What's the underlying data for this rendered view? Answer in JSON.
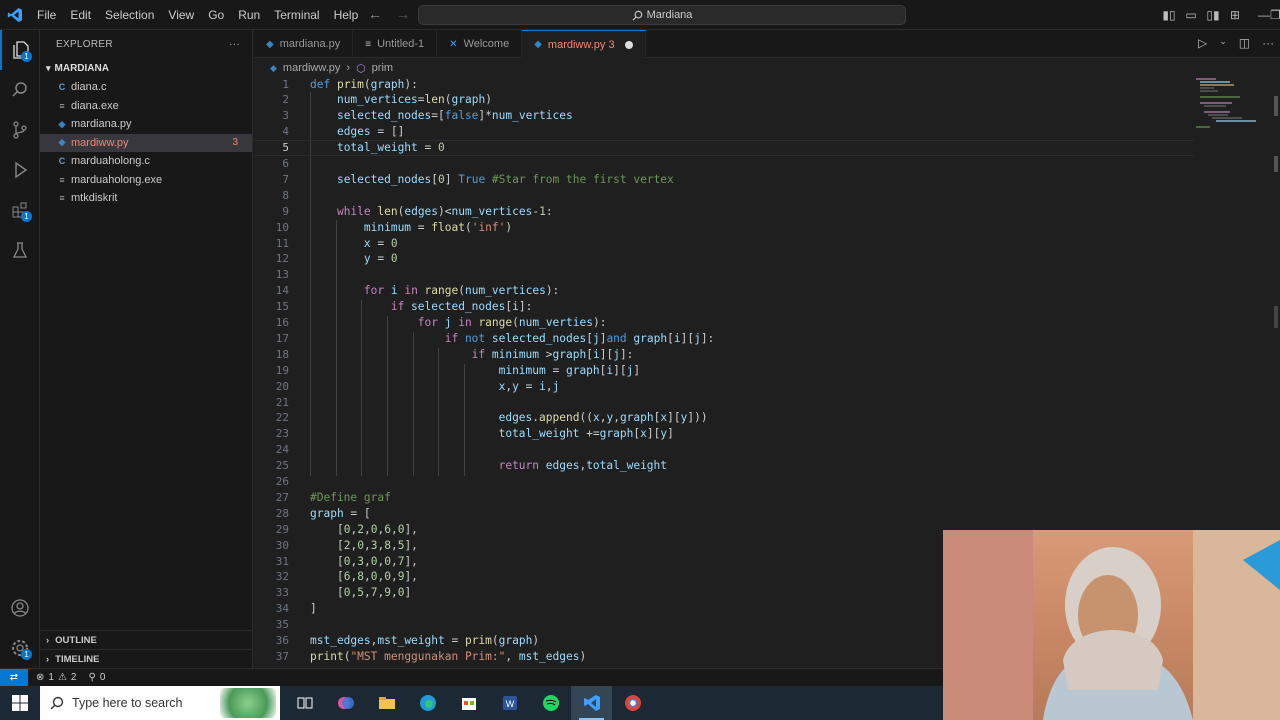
{
  "window": {
    "search_text": "Mardiana",
    "menu": [
      "File",
      "Edit",
      "Selection",
      "View",
      "Go",
      "Run",
      "Terminal",
      "Help"
    ]
  },
  "sidebar": {
    "title": "EXPLORER",
    "folder": "MARDIANA",
    "files": [
      {
        "name": "diana.c",
        "type": "c"
      },
      {
        "name": "diana.exe",
        "type": "exe"
      },
      {
        "name": "mardiana.py",
        "type": "py"
      },
      {
        "name": "mardiww.py",
        "type": "py",
        "selected": true,
        "problems": "3"
      },
      {
        "name": "marduaholong.c",
        "type": "c"
      },
      {
        "name": "marduaholong.exe",
        "type": "exe"
      },
      {
        "name": "mtkdiskrit",
        "type": "exe"
      }
    ],
    "outline_label": "OUTLINE",
    "timeline_label": "TIMELINE"
  },
  "tabs": [
    {
      "label": "mardiana.py",
      "icon": "python-icon"
    },
    {
      "label": "Untitled-1",
      "icon": "text-file-icon"
    },
    {
      "label": "Welcome",
      "icon": "vscode-icon"
    },
    {
      "label": "mardiww.py 3",
      "icon": "python-icon",
      "active": true,
      "modified": true
    }
  ],
  "breadcrumb": {
    "file": "mardiww.py",
    "symbol": "prim"
  },
  "editor": {
    "current_line": 5,
    "lines": [
      {
        "n": "1",
        "t": [
          [
            "kw2",
            "def "
          ],
          [
            "fn",
            "prim"
          ],
          [
            "pl",
            "("
          ],
          [
            "var",
            "graph"
          ],
          [
            "pl",
            "):"
          ]
        ]
      },
      {
        "n": "2",
        "t": [
          [
            "pl",
            "    "
          ],
          [
            "var",
            "num_vertices"
          ],
          [
            "pl",
            "="
          ],
          [
            "fn",
            "len"
          ],
          [
            "pl",
            "("
          ],
          [
            "var",
            "graph"
          ],
          [
            "pl",
            ")"
          ]
        ]
      },
      {
        "n": "3",
        "t": [
          [
            "pl",
            "    "
          ],
          [
            "var",
            "selected_nodes"
          ],
          [
            "pl",
            "=["
          ],
          [
            "kw2",
            "false"
          ],
          [
            "pl",
            "]*"
          ],
          [
            "var",
            "num_vertices"
          ]
        ]
      },
      {
        "n": "4",
        "t": [
          [
            "pl",
            "    "
          ],
          [
            "var",
            "edges"
          ],
          [
            "pl",
            " = []"
          ]
        ]
      },
      {
        "n": "5",
        "t": [
          [
            "pl",
            "    "
          ],
          [
            "var",
            "total_weight"
          ],
          [
            "pl",
            " = "
          ],
          [
            "num",
            "0"
          ]
        ]
      },
      {
        "n": "6",
        "t": []
      },
      {
        "n": "7",
        "t": [
          [
            "pl",
            "    "
          ],
          [
            "var",
            "selected_nodes"
          ],
          [
            "pl",
            "["
          ],
          [
            "num",
            "0"
          ],
          [
            "pl",
            "] "
          ],
          [
            "kw2",
            "True"
          ],
          [
            "cm",
            " #Star from the first vertex"
          ]
        ]
      },
      {
        "n": "8",
        "t": []
      },
      {
        "n": "9",
        "t": [
          [
            "pl",
            "    "
          ],
          [
            "kw",
            "while "
          ],
          [
            "fn",
            "len"
          ],
          [
            "pl",
            "("
          ],
          [
            "var",
            "edges"
          ],
          [
            "pl",
            ")<"
          ],
          [
            "var",
            "num_vertices"
          ],
          [
            "pl",
            "-"
          ],
          [
            "num",
            "1"
          ],
          [
            "pl",
            ":"
          ]
        ]
      },
      {
        "n": "10",
        "t": [
          [
            "pl",
            "        "
          ],
          [
            "var",
            "minimum"
          ],
          [
            "pl",
            " = "
          ],
          [
            "fn",
            "float"
          ],
          [
            "pl",
            "("
          ],
          [
            "str",
            "'inf'"
          ],
          [
            "pl",
            ")"
          ]
        ]
      },
      {
        "n": "11",
        "t": [
          [
            "pl",
            "        "
          ],
          [
            "var",
            "x"
          ],
          [
            "pl",
            " = "
          ],
          [
            "num",
            "0"
          ]
        ]
      },
      {
        "n": "12",
        "t": [
          [
            "pl",
            "        "
          ],
          [
            "var",
            "y"
          ],
          [
            "pl",
            " = "
          ],
          [
            "num",
            "0"
          ]
        ]
      },
      {
        "n": "13",
        "t": []
      },
      {
        "n": "14",
        "t": [
          [
            "pl",
            "        "
          ],
          [
            "kw",
            "for "
          ],
          [
            "var",
            "i"
          ],
          [
            "kw",
            " in "
          ],
          [
            "fn",
            "range"
          ],
          [
            "pl",
            "("
          ],
          [
            "var",
            "num_vertices"
          ],
          [
            "pl",
            "):"
          ]
        ]
      },
      {
        "n": "15",
        "t": [
          [
            "pl",
            "            "
          ],
          [
            "kw",
            "if "
          ],
          [
            "var",
            "selected_nodes"
          ],
          [
            "pl",
            "["
          ],
          [
            "var",
            "i"
          ],
          [
            "pl",
            "]:"
          ]
        ]
      },
      {
        "n": "16",
        "t": [
          [
            "pl",
            "                "
          ],
          [
            "kw",
            "for "
          ],
          [
            "var",
            "j"
          ],
          [
            "kw",
            " in "
          ],
          [
            "fn",
            "range"
          ],
          [
            "pl",
            "("
          ],
          [
            "var",
            "num_verties"
          ],
          [
            "pl",
            "):"
          ]
        ]
      },
      {
        "n": "17",
        "t": [
          [
            "pl",
            "                    "
          ],
          [
            "kw",
            "if "
          ],
          [
            "kw2",
            "not "
          ],
          [
            "var",
            "selected_nodes"
          ],
          [
            "pl",
            "["
          ],
          [
            "var",
            "j"
          ],
          [
            "pl",
            "]"
          ],
          [
            "kw2",
            "and "
          ],
          [
            "var",
            "graph"
          ],
          [
            "pl",
            "["
          ],
          [
            "var",
            "i"
          ],
          [
            "pl",
            "]["
          ],
          [
            "var",
            "j"
          ],
          [
            "pl",
            "]:"
          ]
        ]
      },
      {
        "n": "18",
        "t": [
          [
            "pl",
            "                        "
          ],
          [
            "kw",
            "if "
          ],
          [
            "var",
            "minimum"
          ],
          [
            "pl",
            " >"
          ],
          [
            "var",
            "graph"
          ],
          [
            "pl",
            "["
          ],
          [
            "var",
            "i"
          ],
          [
            "pl",
            "]["
          ],
          [
            "var",
            "j"
          ],
          [
            "pl",
            "]:"
          ]
        ]
      },
      {
        "n": "19",
        "t": [
          [
            "pl",
            "                            "
          ],
          [
            "var",
            "minimum"
          ],
          [
            "pl",
            " = "
          ],
          [
            "var",
            "graph"
          ],
          [
            "pl",
            "["
          ],
          [
            "var",
            "i"
          ],
          [
            "pl",
            "]["
          ],
          [
            "var",
            "j"
          ],
          [
            "pl",
            "]"
          ]
        ]
      },
      {
        "n": "20",
        "t": [
          [
            "pl",
            "                            "
          ],
          [
            "var",
            "x"
          ],
          [
            "pl",
            ","
          ],
          [
            "var",
            "y"
          ],
          [
            "pl",
            " = "
          ],
          [
            "var",
            "i"
          ],
          [
            "pl",
            ","
          ],
          [
            "var",
            "j"
          ]
        ]
      },
      {
        "n": "21",
        "t": []
      },
      {
        "n": "22",
        "t": [
          [
            "pl",
            "                            "
          ],
          [
            "var",
            "edges"
          ],
          [
            "pl",
            "."
          ],
          [
            "fn",
            "append"
          ],
          [
            "pl",
            "(("
          ],
          [
            "var",
            "x"
          ],
          [
            "pl",
            ","
          ],
          [
            "var",
            "y"
          ],
          [
            "pl",
            ","
          ],
          [
            "var",
            "graph"
          ],
          [
            "pl",
            "["
          ],
          [
            "var",
            "x"
          ],
          [
            "pl",
            "]["
          ],
          [
            "var",
            "y"
          ],
          [
            "pl",
            "]))"
          ]
        ]
      },
      {
        "n": "23",
        "t": [
          [
            "pl",
            "                            "
          ],
          [
            "var",
            "total_weight"
          ],
          [
            "pl",
            " +="
          ],
          [
            "var",
            "graph"
          ],
          [
            "pl",
            "["
          ],
          [
            "var",
            "x"
          ],
          [
            "pl",
            "]["
          ],
          [
            "var",
            "y"
          ],
          [
            "pl",
            "]"
          ]
        ]
      },
      {
        "n": "24",
        "t": []
      },
      {
        "n": "25",
        "t": [
          [
            "pl",
            "                            "
          ],
          [
            "kw",
            "return "
          ],
          [
            "var",
            "edges"
          ],
          [
            "pl",
            ","
          ],
          [
            "var",
            "total_weight"
          ]
        ]
      },
      {
        "n": "26",
        "t": []
      },
      {
        "n": "27",
        "t": [
          [
            "cm",
            "#Define graf"
          ]
        ]
      },
      {
        "n": "28",
        "t": [
          [
            "var",
            "graph"
          ],
          [
            "pl",
            " = ["
          ]
        ]
      },
      {
        "n": "29",
        "t": [
          [
            "pl",
            "    ["
          ],
          [
            "num",
            "0"
          ],
          [
            "pl",
            ","
          ],
          [
            "num",
            "2"
          ],
          [
            "pl",
            ","
          ],
          [
            "num",
            "0"
          ],
          [
            "pl",
            ","
          ],
          [
            "num",
            "6"
          ],
          [
            "pl",
            ","
          ],
          [
            "num",
            "0"
          ],
          [
            "pl",
            "],"
          ]
        ]
      },
      {
        "n": "30",
        "t": [
          [
            "pl",
            "    ["
          ],
          [
            "num",
            "2"
          ],
          [
            "pl",
            ","
          ],
          [
            "num",
            "0"
          ],
          [
            "pl",
            ","
          ],
          [
            "num",
            "3"
          ],
          [
            "pl",
            ","
          ],
          [
            "num",
            "8"
          ],
          [
            "pl",
            ","
          ],
          [
            "num",
            "5"
          ],
          [
            "pl",
            "],"
          ]
        ]
      },
      {
        "n": "31",
        "t": [
          [
            "pl",
            "    ["
          ],
          [
            "num",
            "0"
          ],
          [
            "pl",
            ","
          ],
          [
            "num",
            "3"
          ],
          [
            "pl",
            ","
          ],
          [
            "num",
            "0"
          ],
          [
            "pl",
            ","
          ],
          [
            "num",
            "0"
          ],
          [
            "pl",
            ","
          ],
          [
            "num",
            "7"
          ],
          [
            "pl",
            "],"
          ]
        ]
      },
      {
        "n": "32",
        "t": [
          [
            "pl",
            "    ["
          ],
          [
            "num",
            "6"
          ],
          [
            "pl",
            ","
          ],
          [
            "num",
            "8"
          ],
          [
            "pl",
            ","
          ],
          [
            "num",
            "0"
          ],
          [
            "pl",
            ","
          ],
          [
            "num",
            "0"
          ],
          [
            "pl",
            ","
          ],
          [
            "num",
            "9"
          ],
          [
            "pl",
            "],"
          ]
        ]
      },
      {
        "n": "33",
        "t": [
          [
            "pl",
            "    ["
          ],
          [
            "num",
            "0"
          ],
          [
            "pl",
            ","
          ],
          [
            "num",
            "5"
          ],
          [
            "pl",
            ","
          ],
          [
            "num",
            "7"
          ],
          [
            "pl",
            ","
          ],
          [
            "num",
            "9"
          ],
          [
            "pl",
            ","
          ],
          [
            "num",
            "0"
          ],
          [
            "pl",
            "]"
          ]
        ]
      },
      {
        "n": "34",
        "t": [
          [
            "pl",
            "]"
          ]
        ]
      },
      {
        "n": "35",
        "t": []
      },
      {
        "n": "36",
        "t": [
          [
            "var",
            "mst_edges"
          ],
          [
            "pl",
            ","
          ],
          [
            "var",
            "mst_weight"
          ],
          [
            "pl",
            " = "
          ],
          [
            "fn",
            "prim"
          ],
          [
            "pl",
            "("
          ],
          [
            "var",
            "graph"
          ],
          [
            "pl",
            ")"
          ]
        ]
      },
      {
        "n": "37",
        "t": [
          [
            "fn",
            "print"
          ],
          [
            "pl",
            "("
          ],
          [
            "str",
            "\"MST menggunakan Prim:\""
          ],
          [
            "pl",
            ", "
          ],
          [
            "var",
            "mst_edges"
          ],
          [
            "pl",
            ")"
          ]
        ]
      }
    ]
  },
  "status": {
    "errors": "1",
    "warnings": "2",
    "ports": "0"
  },
  "taskbar": {
    "search_placeholder": "Type here to search",
    "apps": [
      "task-view-icon",
      "copilot-icon",
      "file-explorer-icon",
      "edge-icon",
      "store-icon",
      "word-icon",
      "spotify-icon",
      "vscode-icon",
      "chrome-icon"
    ]
  },
  "colors": {
    "accent": "#0078d4",
    "error": "#f48771",
    "background": "#1f1f1f"
  }
}
